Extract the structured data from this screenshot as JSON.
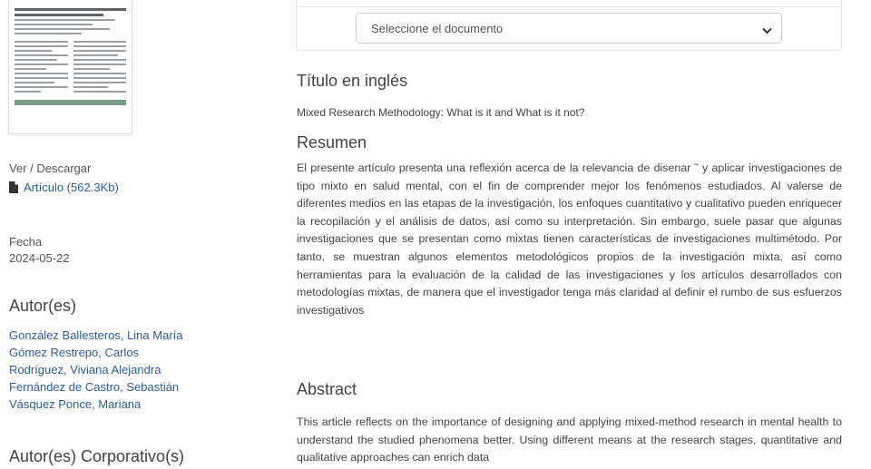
{
  "sidebar": {
    "view_download_label": "Ver / Descargar",
    "file_link": "Artículo (562.3Kb)",
    "date_label": "Fecha",
    "date_value": "2024-05-22",
    "authors_heading": "Autor(es)",
    "authors": [
      "González Ballesteros, Lina María",
      "Gómez Restrepo, Carlos",
      "Rodríguez, Viviana Alejandra",
      "Fernández de Castro, Sebastián",
      "Vásquez Ponce, Mariana"
    ],
    "corporate_authors_heading": "Autor(es) Corporativo(s)"
  },
  "main": {
    "document_select": {
      "selected": "Seleccione el documento"
    },
    "english_title_heading": "Título en inglés",
    "english_title": "Mixed Research Methodology: What is it and What is it not?",
    "resumen_heading": "Resumen",
    "resumen": "El presente artículo presenta una reflexión acerca de la relevancia de disenar ˜ y aplicar investigaciones de tipo mixto en salud mental, con el fin de comprender mejor los fenómenos estudiados. Al valerse de diferentes medios en las etapas de la investigación, los enfoques cuantitativo y cualitativo pueden enriquecer la recopilación y el análisis de datos, así como su interpretación. Sin embargo, suele pasar que algunas investigaciones que se presentan como mixtas tienen características de investigaciones multimétodo. Por tanto, se muestran algunos elementos metodológicos propios de la investigación mixta, así como herramientas para la evaluación de la calidad de las investigaciones y los artículos desarrollados con metodologías mixtas, de manera que el investigador tenga más claridad al definir el rumbo de sus esfuerzos investigativos",
    "abstract_heading": "Abstract",
    "abstract": "This article reflects on the importance of designing and applying mixed-method research in mental health to understand the studied phenomena better. Using different means at the research stages, quantitative and qualitative approaches can enrich data"
  },
  "icons": {
    "file": "file-icon",
    "chevron": "chevron-down-icon"
  },
  "colors": {
    "link": "#2a5d9f",
    "text": "#444444"
  }
}
